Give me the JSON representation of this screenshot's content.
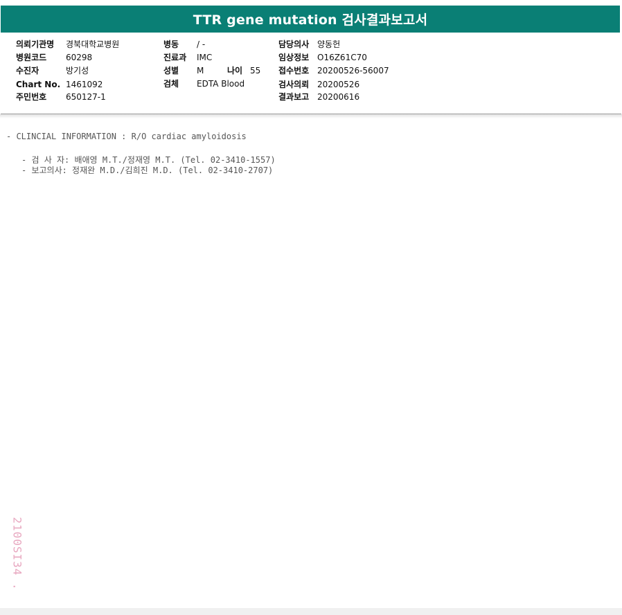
{
  "header": {
    "title": "TTR gene mutation 검사결과보고서"
  },
  "patient_info": {
    "col1": [
      {
        "label": "의뢰기관명",
        "value": "경북대학교병원"
      },
      {
        "label": "병원코드",
        "value": "60298"
      },
      {
        "label": "수진자",
        "value": "방기성"
      },
      {
        "label": "Chart No.",
        "value": "1461092"
      },
      {
        "label": "주민번호",
        "value": "650127-1"
      }
    ],
    "col2": [
      {
        "label": "병동",
        "value": " / -"
      },
      {
        "label": "진료과",
        "value": "IMC"
      },
      {
        "label": "성별",
        "value": "M"
      },
      {
        "label": "검체",
        "value": "EDTA Blood"
      }
    ],
    "age": {
      "label": "나이",
      "value": "55"
    },
    "col3": [
      {
        "label": "담당의사",
        "value": "양동헌"
      },
      {
        "label": "임상정보",
        "value": "O16Z61C70"
      },
      {
        "label": "접수번호",
        "value": "20200526-56007"
      },
      {
        "label": "검사의뢰",
        "value": "20200526"
      },
      {
        "label": "결과보고",
        "value": "20200616"
      }
    ]
  },
  "report": {
    "clinical_info": "- CLINCIAL INFORMATION : R/O cardiac amyloidosis",
    "tester": "- 검 사 자: 배애영 M.T./정재영 M.T. (Tel. 02-3410-1557)",
    "reporter": "- 보고의사: 정재완 M.D./김희진 M.D. (Tel. 02-3410-2707)"
  },
  "watermark": "2100SI34 ."
}
